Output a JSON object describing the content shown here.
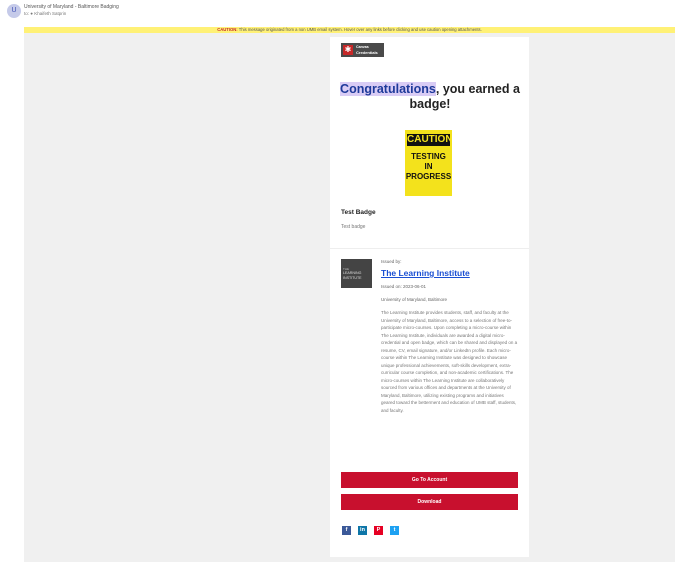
{
  "email": {
    "avatar_initials": "U",
    "sender": "University of Maryland - Baltimore Badging",
    "recipient": "to: ● Khaifeth Satprin"
  },
  "caution_banner": {
    "label": "CAUTION:",
    "text": " This message originated from a non UMB email system. Hover over any links before clicking and use caution opening attachments."
  },
  "logo": {
    "line1": "Canvas",
    "line2": "Credentials",
    "star": "✱"
  },
  "congrats": {
    "highlight": "Congratulations",
    "rest": ", you earned a badge!"
  },
  "badge": {
    "image_lines": [
      "CAUTION",
      "TESTING",
      "IN",
      "PROGRESS"
    ],
    "name": "Test Badge",
    "description": "Test badge"
  },
  "issuer": {
    "logo_lines": [
      "THE",
      "LEARNING",
      "INSTITUTE"
    ],
    "issued_by_label": "Issued by:",
    "name": "The Learning Institute",
    "issued_on": "Issued on: 2023-06-01",
    "org": "University of Maryland, Baltimore",
    "description": "The Learning Institute provides students, staff, and faculty at the University of Maryland, Baltimore, access to a selection of free-to-participate micro-courses. Upon completing a micro-course within The Learning Institute, individuals are awarded a digital micro-credential and open badge, which can be shared and displayed on a resume, CV, email signature, and/or LinkedIn profile. Each micro-course within The Learning Institute was designed to showcase unique professional achievements, soft-skills development, extra-curricular course completion, and non-academic certifications. The micro-courses within The Learning Institute are collaboratively sourced from various offices and departments at the University of Maryland, Baltimore, utilizing existing programs and initiatives geared toward the betterment and education of UMB staff, students, and faculty."
  },
  "buttons": {
    "go_to_account": "Go To Account",
    "download": "Download"
  },
  "social": [
    {
      "icon": "facebook-icon",
      "glyph": "f",
      "color": "#3b5998"
    },
    {
      "icon": "linkedin-icon",
      "glyph": "in",
      "color": "#0e76a8"
    },
    {
      "icon": "pinterest-icon",
      "glyph": "P",
      "color": "#e60023"
    },
    {
      "icon": "twitter-icon",
      "glyph": "t",
      "color": "#1da1f2"
    }
  ],
  "colors": {
    "accent": "#c8102e",
    "link": "#1a4fd3",
    "highlight": "#d9ccf5",
    "banner": "#fff176"
  }
}
